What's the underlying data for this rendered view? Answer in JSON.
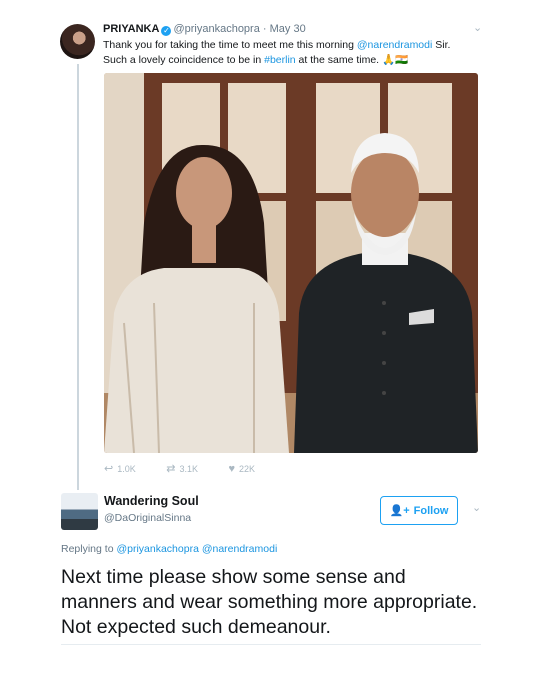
{
  "tweet": {
    "display_name": "PRIYANKA",
    "handle": "@priyankachopra",
    "date_sep": "·",
    "date": "May 30",
    "text_line1_a": "Thank you for taking the time to meet me this morning ",
    "mention": "@narendramodi",
    "text_line1_b": " Sir.",
    "text_line2_a": "Such a lovely coincidence to be in ",
    "hashtag": "#berlin",
    "text_line2_b": " at the same time. ",
    "emoji": "🙏🇮🇳",
    "reply_count": "1.0K",
    "retweet_count": "3.1K",
    "like_count": "22K"
  },
  "reply": {
    "display_name": "Wandering Soul",
    "handle": "@DaOriginalSinna",
    "follow_label": "Follow",
    "replying_prefix": "Replying to",
    "replying_to_1": "@priyankachopra",
    "replying_to_2": "@narendramodi",
    "text": "Next time please show some sense and manners and wear something more appropriate. Not expected such demeanour."
  },
  "icons": {
    "verified": "verified-badge-icon",
    "caret": "chevron-down-icon",
    "reply": "reply-icon",
    "retweet": "retweet-icon",
    "like": "heart-icon",
    "follow": "add-user-icon"
  },
  "colors": {
    "accent": "#1da1f2",
    "link": "#1b95e0",
    "muted": "#657786",
    "action": "#aab8c2"
  }
}
